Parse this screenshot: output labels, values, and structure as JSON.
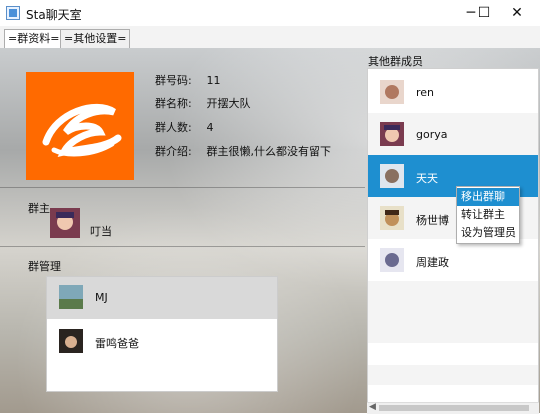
{
  "window": {
    "title": "Sta聊天室",
    "min_glyph": "─",
    "max_glyph": "☐",
    "close_glyph": "✕"
  },
  "tabs": [
    {
      "label": "=群资料=",
      "active": true
    },
    {
      "label": "=其他设置=",
      "active": false
    }
  ],
  "group_info": {
    "number_label": "群号码:",
    "number": "11",
    "name_label": "群名称:",
    "name": "开摆大队",
    "count_label": "群人数:",
    "count": "4",
    "intro_label": "群介绍:",
    "intro": "群主很懒,什么都没有留下"
  },
  "owner": {
    "section_label": "群主",
    "name": "叮当"
  },
  "admins": {
    "section_label": "群管理",
    "items": [
      {
        "name": "MJ",
        "selected": true
      },
      {
        "name": "雷鸣爸爸",
        "selected": false
      }
    ]
  },
  "members": {
    "title": "其他群成员",
    "items": [
      {
        "name": "ren"
      },
      {
        "name": "gorya"
      },
      {
        "name": "天天",
        "selected": true
      },
      {
        "name": "杨世博"
      },
      {
        "name": "周建政"
      }
    ]
  },
  "context_menu": {
    "items": [
      {
        "label": "移出群聊",
        "highlighted": true
      },
      {
        "label": "转让群主"
      },
      {
        "label": "设为管理员"
      }
    ]
  },
  "colors": {
    "accent": "#1e8fd0",
    "logo": "#ff6a00"
  }
}
